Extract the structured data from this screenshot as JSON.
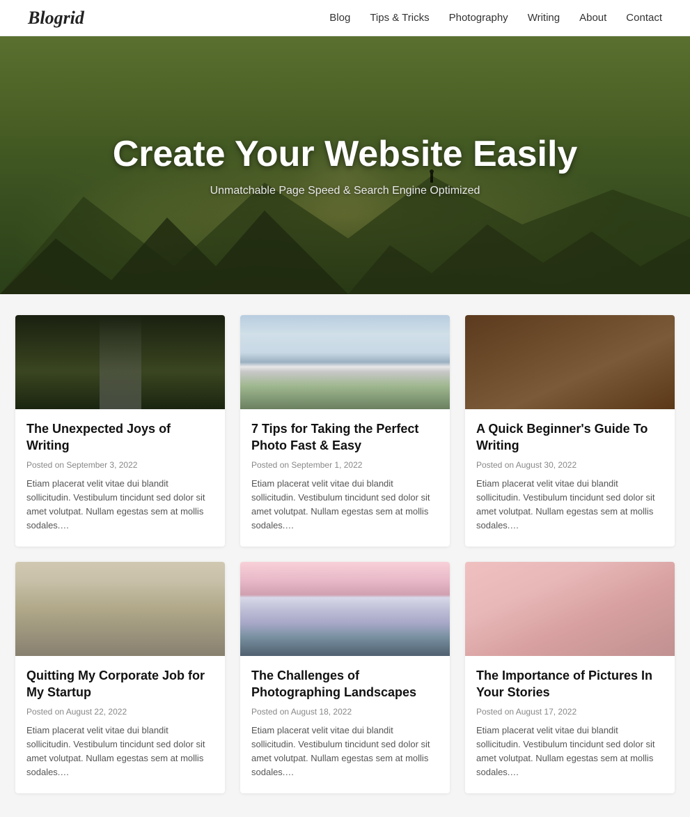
{
  "site": {
    "logo": "Blogrid"
  },
  "nav": {
    "items": [
      {
        "label": "Blog",
        "href": "#"
      },
      {
        "label": "Tips & Tricks",
        "href": "#"
      },
      {
        "label": "Photography",
        "href": "#"
      },
      {
        "label": "Writing",
        "href": "#"
      },
      {
        "label": "About",
        "href": "#"
      },
      {
        "label": "Contact",
        "href": "#"
      }
    ]
  },
  "hero": {
    "title": "Create Your Website Easily",
    "subtitle": "Unmatchable Page Speed & Search Engine Optimized"
  },
  "cards": [
    {
      "id": "card-1",
      "image_class": "img-forest",
      "title": "The Unexpected Joys of Writing",
      "date": "Posted on September 3, 2022",
      "excerpt": "Etiam placerat velit vitae dui blandit sollicitudin. Vestibulum tincidunt sed dolor sit amet volutpat. Nullam egestas sem at mollis sodales.…"
    },
    {
      "id": "card-2",
      "image_class": "img-mountain",
      "title": "7 Tips for Taking the Perfect Photo Fast & Easy",
      "date": "Posted on September 1, 2022",
      "excerpt": "Etiam placerat velit vitae dui blandit sollicitudin. Vestibulum tincidunt sed dolor sit amet volutpat. Nullam egestas sem at mollis sodales.…"
    },
    {
      "id": "card-3",
      "image_class": "img-desk",
      "title": "A Quick Beginner's Guide To Writing",
      "date": "Posted on August 30, 2022",
      "excerpt": "Etiam placerat velit vitae dui blandit sollicitudin. Vestibulum tincidunt sed dolor sit amet volutpat. Nullam egestas sem at mollis sodales.…"
    },
    {
      "id": "card-4",
      "image_class": "img-office",
      "title": "Quitting My Corporate Job for My Startup",
      "date": "Posted on August 22, 2022",
      "excerpt": "Etiam placerat velit vitae dui blandit sollicitudin. Vestibulum tincidunt sed dolor sit amet volutpat. Nullam egestas sem at mollis sodales.…"
    },
    {
      "id": "card-5",
      "image_class": "img-pink-mountain",
      "title": "The Challenges of Photographing Landscapes",
      "date": "Posted on August 18, 2022",
      "excerpt": "Etiam placerat velit vitae dui blandit sollicitudin. Vestibulum tincidunt sed dolor sit amet volutpat. Nullam egestas sem at mollis sodales.…"
    },
    {
      "id": "card-6",
      "image_class": "img-photo-art",
      "title": "The Importance of Pictures In Your Stories",
      "date": "Posted on August 17, 2022",
      "excerpt": "Etiam placerat velit vitae dui blandit sollicitudin. Vestibulum tincidunt sed dolor sit amet volutpat. Nullam egestas sem at mollis sodales.…"
    }
  ]
}
